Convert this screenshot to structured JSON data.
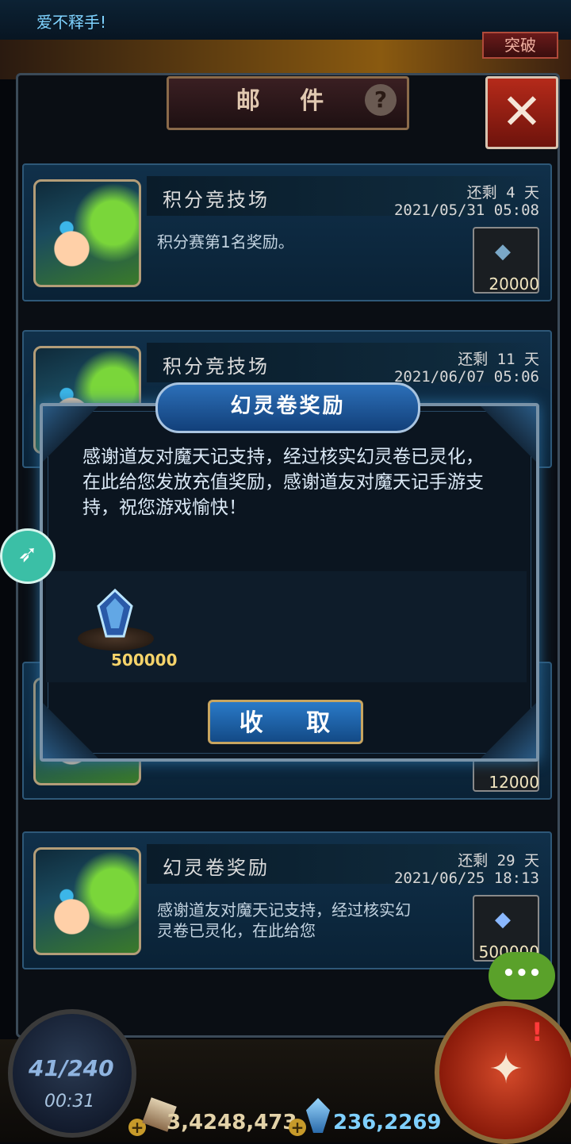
{
  "top": {
    "marquee": "爱不释手!",
    "tag": "突破"
  },
  "panel": {
    "title": "邮 件",
    "help": "?",
    "close": "✕"
  },
  "mails": [
    {
      "title": "积分竞技场",
      "remain": "还剩 4 天",
      "date": "2021/05/31 05:08",
      "preview": "积分赛第1名奖励。",
      "reward_qty": "20000"
    },
    {
      "title": "积分竞技场",
      "remain": "还剩 11 天",
      "date": "2021/06/07 05:06",
      "preview": "",
      "reward_qty": ""
    },
    {
      "title": "",
      "remain": "",
      "date": "",
      "preview": "",
      "reward_qty": "12000"
    },
    {
      "title": "幻灵卷奖励",
      "remain": "还剩 29 天",
      "date": "2021/06/25 18:13",
      "preview": "感谢道友对魔天记支持，经过核实幻灵卷已灵化，在此给您",
      "reward_qty": "500000"
    }
  ],
  "modal": {
    "title": "幻灵卷奖励",
    "body": "感谢道友对魔天记支持，经过核实幻灵卷已灵化，在此给您发放充值奖励，感谢道友对魔天记手游支持，祝您游戏愉快！",
    "reward_qty": "500000",
    "claim_label": "收 取"
  },
  "hud": {
    "energy": "41/240",
    "timer": "00:31",
    "gold": "3,4248,473",
    "gems": "236,2269"
  },
  "colors": {
    "accent": "#2a7ac8",
    "gold_text": "#f5d36a",
    "close_red": "#b52a1a"
  },
  "icons": {
    "help": "question-icon",
    "close": "close-icon",
    "rocket": "rocket-icon",
    "chat": "chat-icon",
    "crystal": "crystal-icon"
  }
}
